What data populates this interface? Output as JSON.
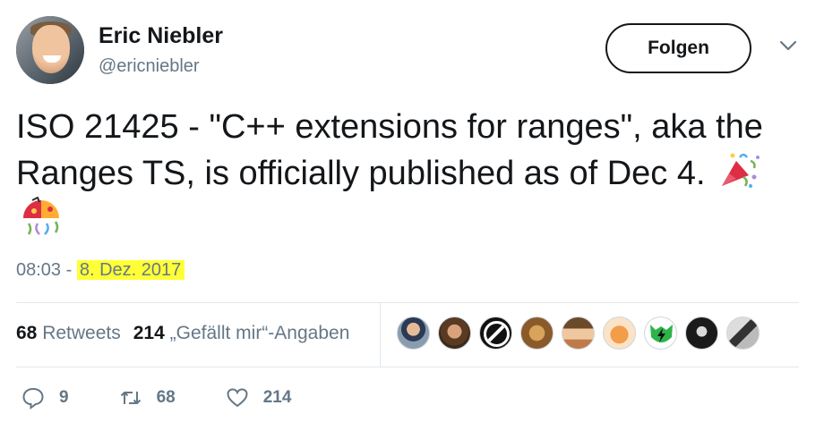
{
  "author": {
    "name": "Eric Niebler",
    "handle": "@ericniebler"
  },
  "follow_label": "Folgen",
  "tweet": {
    "text": "ISO 21425 - \"C++ extensions for ranges\", aka the Ranges TS, is officially published as of Dec 4.",
    "time": "08:03",
    "separator": " - ",
    "date": "8. Dez. 2017",
    "highlight_color": "#ffff37"
  },
  "stats": {
    "retweets_count": "68",
    "retweets_label": "Retweets",
    "likes_count": "214",
    "likes_label": "„Gefällt mir“-Angaben"
  },
  "likers": [
    {
      "icon": "avatar-man-suit"
    },
    {
      "icon": "avatar-bearded-man"
    },
    {
      "icon": "avatar-black-white-logo"
    },
    {
      "icon": "avatar-lion"
    },
    {
      "icon": "avatar-cowboy-hat"
    },
    {
      "icon": "avatar-orange-cat"
    },
    {
      "icon": "avatar-green-lightning"
    },
    {
      "icon": "avatar-dark-hair-woman"
    },
    {
      "icon": "avatar-cat-keyboard"
    }
  ],
  "actions": {
    "reply_count": "9",
    "retweet_count": "68",
    "like_count": "214"
  },
  "colors": {
    "text": "#14171a",
    "muted": "#657786",
    "border": "#e1e8ed"
  }
}
